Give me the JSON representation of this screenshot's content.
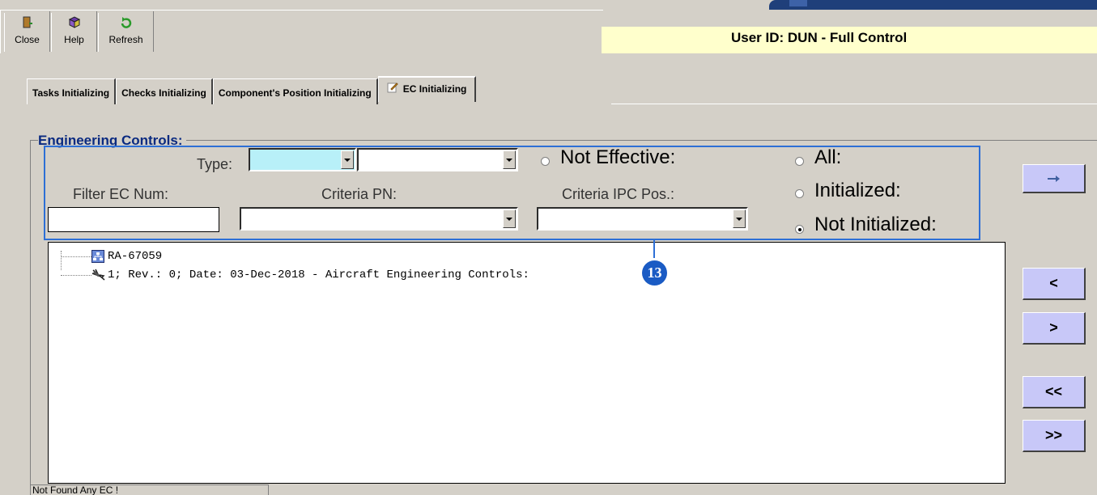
{
  "toolbar": {
    "close_label": "Close",
    "help_label": "Help",
    "refresh_label": "Refresh"
  },
  "user_banner": "User ID: DUN - Full Control",
  "tabs": [
    {
      "label": "Tasks Initializing"
    },
    {
      "label": "Checks Initializing"
    },
    {
      "label": "Component's Position Initializing"
    },
    {
      "label": "EC Initializing"
    }
  ],
  "group_title": "Engineering Controls:",
  "filters": {
    "type_label": "Type:",
    "filter_ec_label": "Filter EC Num:",
    "criteria_pn_label": "Criteria PN:",
    "criteria_ipc_label": "Criteria IPC Pos.:",
    "filter_ec_value": "",
    "type_value": ""
  },
  "radios": {
    "not_effective": "Not Effective:",
    "all": "All:",
    "initialized": "Initialized:",
    "not_initialized": "Not Initialized:",
    "selected": "not_initialized"
  },
  "callout_number": "13",
  "tree": {
    "root": "RA-67059",
    "child": "1; Rev.: 0; Date: 03-Dec-2018 - Aircraft Engineering Controls:"
  },
  "status_text": "Not Found Any EC !",
  "nav_buttons": {
    "prev": "<",
    "next": ">",
    "first": "<<",
    "last": ">>"
  },
  "colors": {
    "accent_blue": "#2d6fd6",
    "button_lavender": "#c8c8f8",
    "banner_yellow": "#ffffcc",
    "type_combo_fill": "#b8f0f8"
  }
}
